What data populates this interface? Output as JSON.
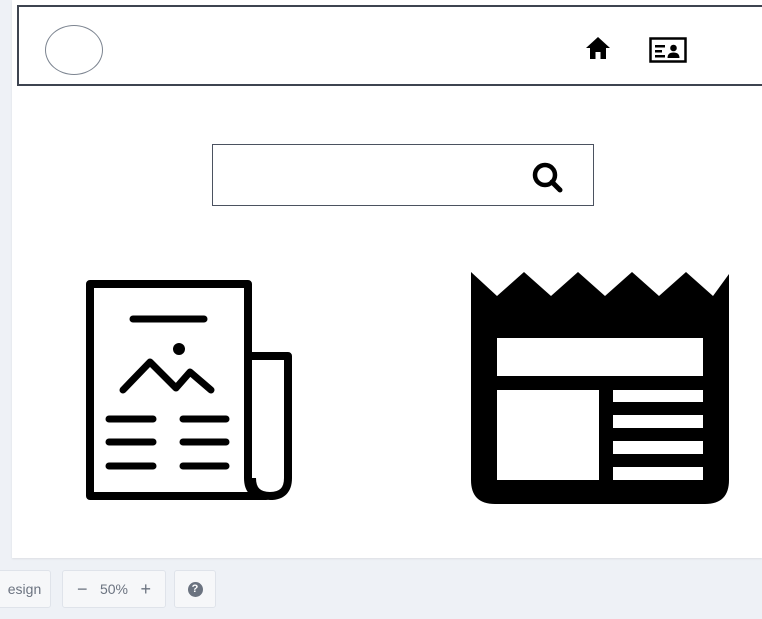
{
  "header": {
    "nav_icons": [
      "home-icon",
      "contact-card-icon"
    ]
  },
  "search": {
    "value": "",
    "placeholder": "",
    "icon": "search-icon"
  },
  "content": {
    "icons": [
      "newspaper-outline-icon",
      "newspaper-solid-icon"
    ]
  },
  "toolbar": {
    "design_label": "esign",
    "zoom_minus": "−",
    "zoom_level": "50%",
    "zoom_plus": "+",
    "help_label": "?"
  },
  "colors": {
    "canvas_bg": "#ffffff",
    "app_bg": "#eef1f6",
    "header_border": "#3e4450",
    "icon_fill": "#000000",
    "toolbar_text": "#6b7380"
  }
}
